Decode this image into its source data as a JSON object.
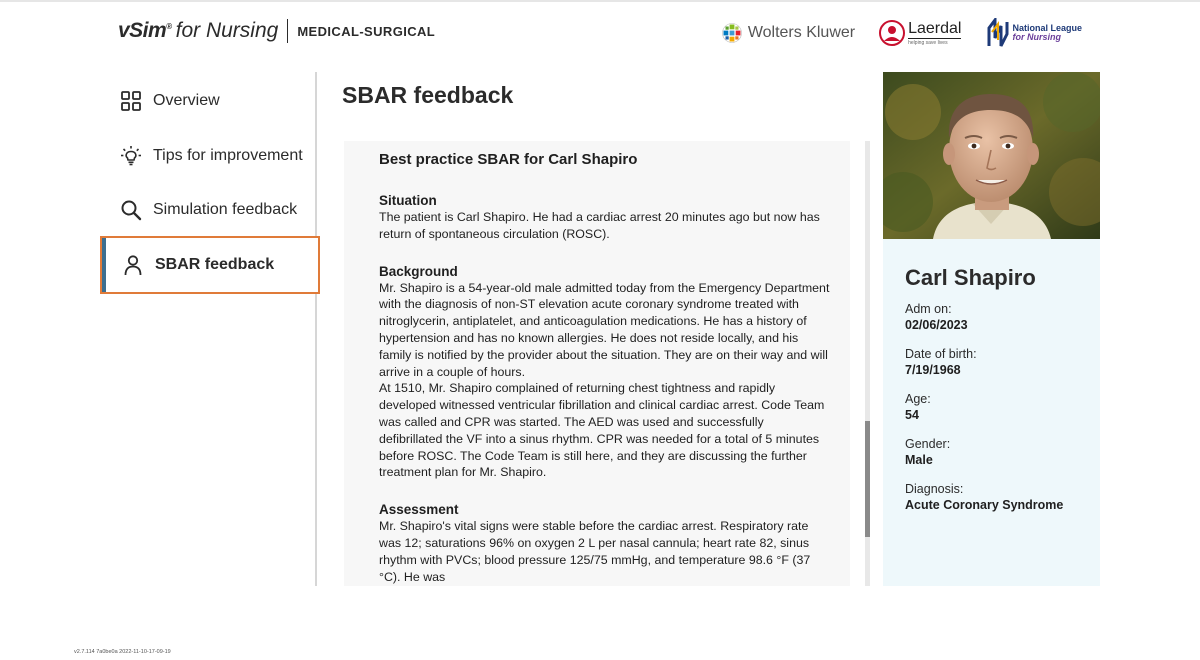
{
  "header": {
    "brand_vsim": "vSim",
    "brand_tm": "®",
    "brand_for": "for Nursing",
    "brand_module": "MEDICAL-SURGICAL",
    "partners": {
      "wolters_kluwer": "Wolters Kluwer",
      "laerdal_name": "Laerdal",
      "laerdal_tagline": "helping save lives",
      "nln_line1": "National League",
      "nln_line2": "for Nursing"
    }
  },
  "sidebar": {
    "items": [
      {
        "label": "Overview",
        "icon": "grid-icon",
        "active": false
      },
      {
        "label": "Tips for improvement",
        "icon": "lightbulb-icon",
        "active": false
      },
      {
        "label": "Simulation feedback",
        "icon": "search-icon",
        "active": false
      },
      {
        "label": "SBAR feedback",
        "icon": "person-icon",
        "active": true
      }
    ]
  },
  "main": {
    "title": "SBAR feedback",
    "doc_title": "Best practice SBAR for Carl Shapiro",
    "sections": [
      {
        "heading": "Situation",
        "paragraphs": [
          "The patient is Carl Shapiro. He had a cardiac arrest 20 minutes ago but now has return of spontaneous circulation (ROSC)."
        ]
      },
      {
        "heading": "Background",
        "paragraphs": [
          "Mr. Shapiro is a 54-year-old male admitted today from the Emergency Department with the diagnosis of non-ST elevation acute coronary syndrome treated with nitroglycerin, antiplatelet, and anticoagulation medications. He has a history of hypertension and has no known allergies. He does not reside locally, and his family is notified by the provider about the situation. They are on their way and will arrive in a couple of hours.",
          "At 1510, Mr. Shapiro complained of returning chest tightness and rapidly developed witnessed ventricular fibrillation and clinical cardiac arrest. Code Team was called and CPR was started. The AED was used and successfully defibrillated the VF into a sinus rhythm. CPR was needed for a total of 5 minutes before ROSC. The Code Team is still here, and they are discussing the further treatment plan for Mr. Shapiro."
        ]
      },
      {
        "heading": "Assessment",
        "paragraphs": [
          "Mr. Shapiro's vital signs were stable before the cardiac arrest. Respiratory rate was 12; saturations 96% on oxygen 2 L per nasal cannula; heart rate 82, sinus rhythm with PVCs; blood pressure 125/75 mmHg, and temperature 98.6 °F (37 °C). He was"
        ]
      }
    ]
  },
  "patient": {
    "name": "Carl Shapiro",
    "fields": [
      {
        "label": "Adm on:",
        "value": "02/06/2023"
      },
      {
        "label": "Date of birth:",
        "value": "7/19/1968"
      },
      {
        "label": "Age:",
        "value": "54"
      },
      {
        "label": "Gender:",
        "value": "Male"
      },
      {
        "label": "Diagnosis:",
        "value": "Acute Coronary Syndrome"
      }
    ]
  },
  "footer": {
    "version": "v2.7.114 7a0be0a 2022-11-10-17-09-19"
  },
  "colors": {
    "active_border": "#e07b39",
    "active_bar": "#3c6e8f",
    "patient_panel_bg": "#eef8fb",
    "content_bg": "#f7f7f7"
  }
}
